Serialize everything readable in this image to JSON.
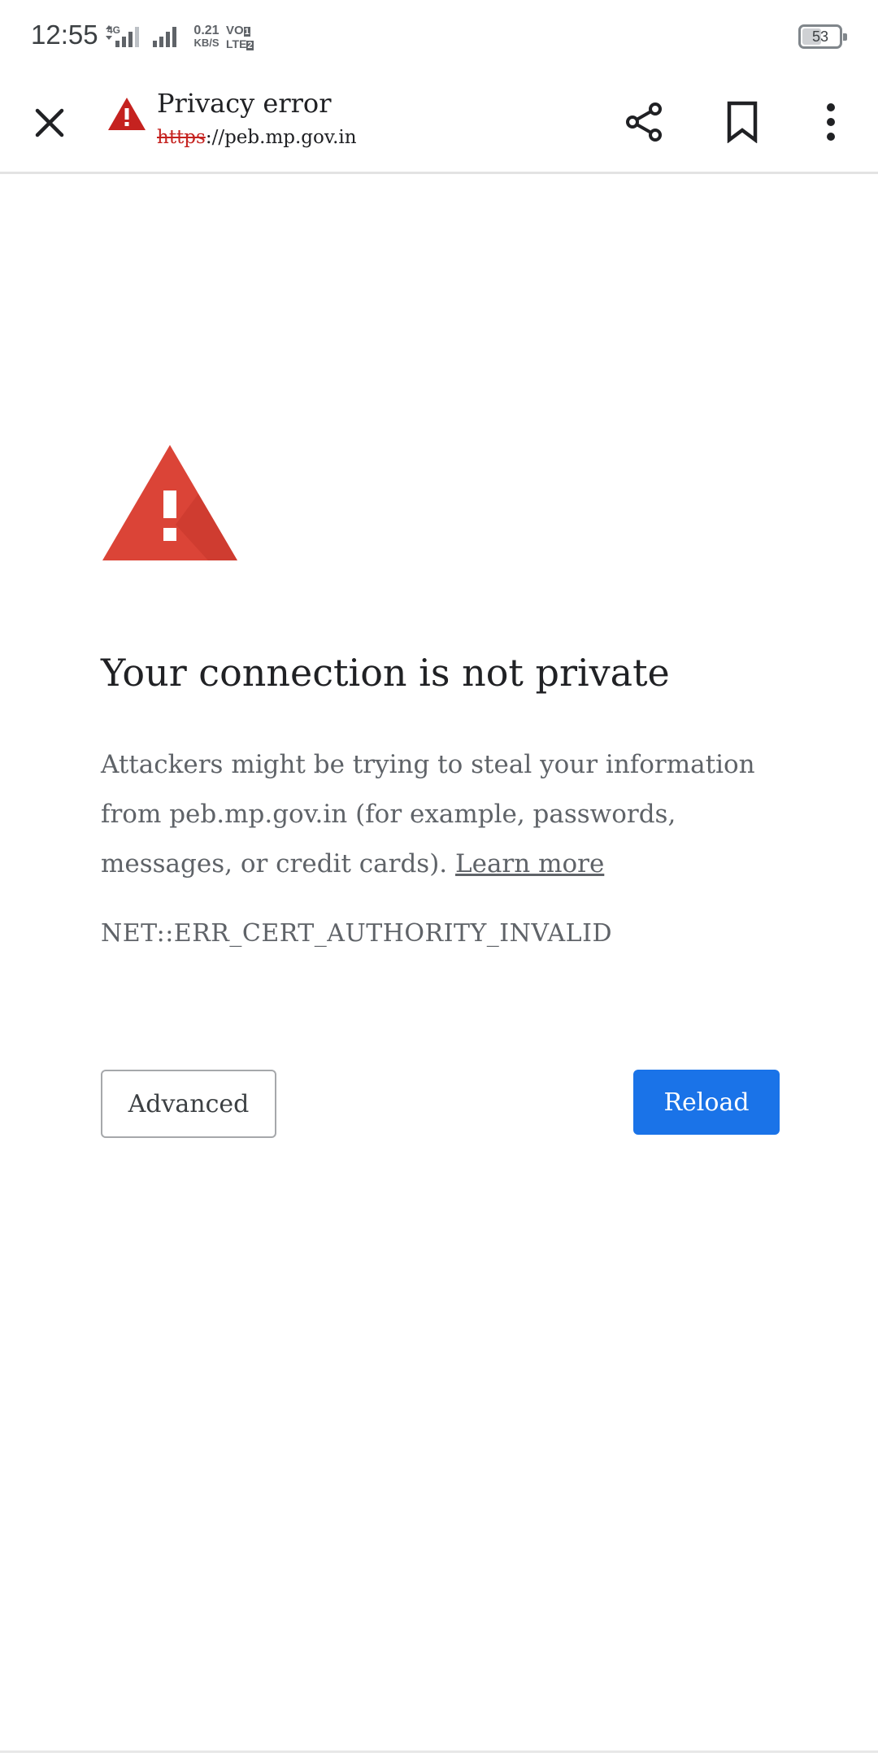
{
  "status_bar": {
    "time": "12:55",
    "network_type": "4G",
    "speed_value": "0.21",
    "speed_unit": "KB/S",
    "volte_top": "VO",
    "volte_bottom": "LTE",
    "volte_sim1": "1",
    "volte_sim2": "2",
    "battery_level": "53",
    "battery_fraction": 0.53
  },
  "toolbar": {
    "title": "Privacy error",
    "url_scheme": "https",
    "url_rest": "://peb.mp.gov.in",
    "icons": [
      "close-icon",
      "warning-icon",
      "share-icon",
      "bookmark-icon",
      "more-vert-icon"
    ]
  },
  "interstitial": {
    "heading": "Your connection is not private",
    "paragraph": "Attackers might be trying to steal your information from peb.mp.gov.in (for example, passwords, messages, or credit cards).",
    "learn_more": "Learn more",
    "error_code": "NET::ERR_CERT_AUTHORITY_INVALID",
    "advanced_label": "Advanced",
    "reload_label": "Reload"
  },
  "colors": {
    "warning_red": "#d93025",
    "button_blue": "#1a73e8",
    "url_scheme_red": "#c5221f"
  }
}
